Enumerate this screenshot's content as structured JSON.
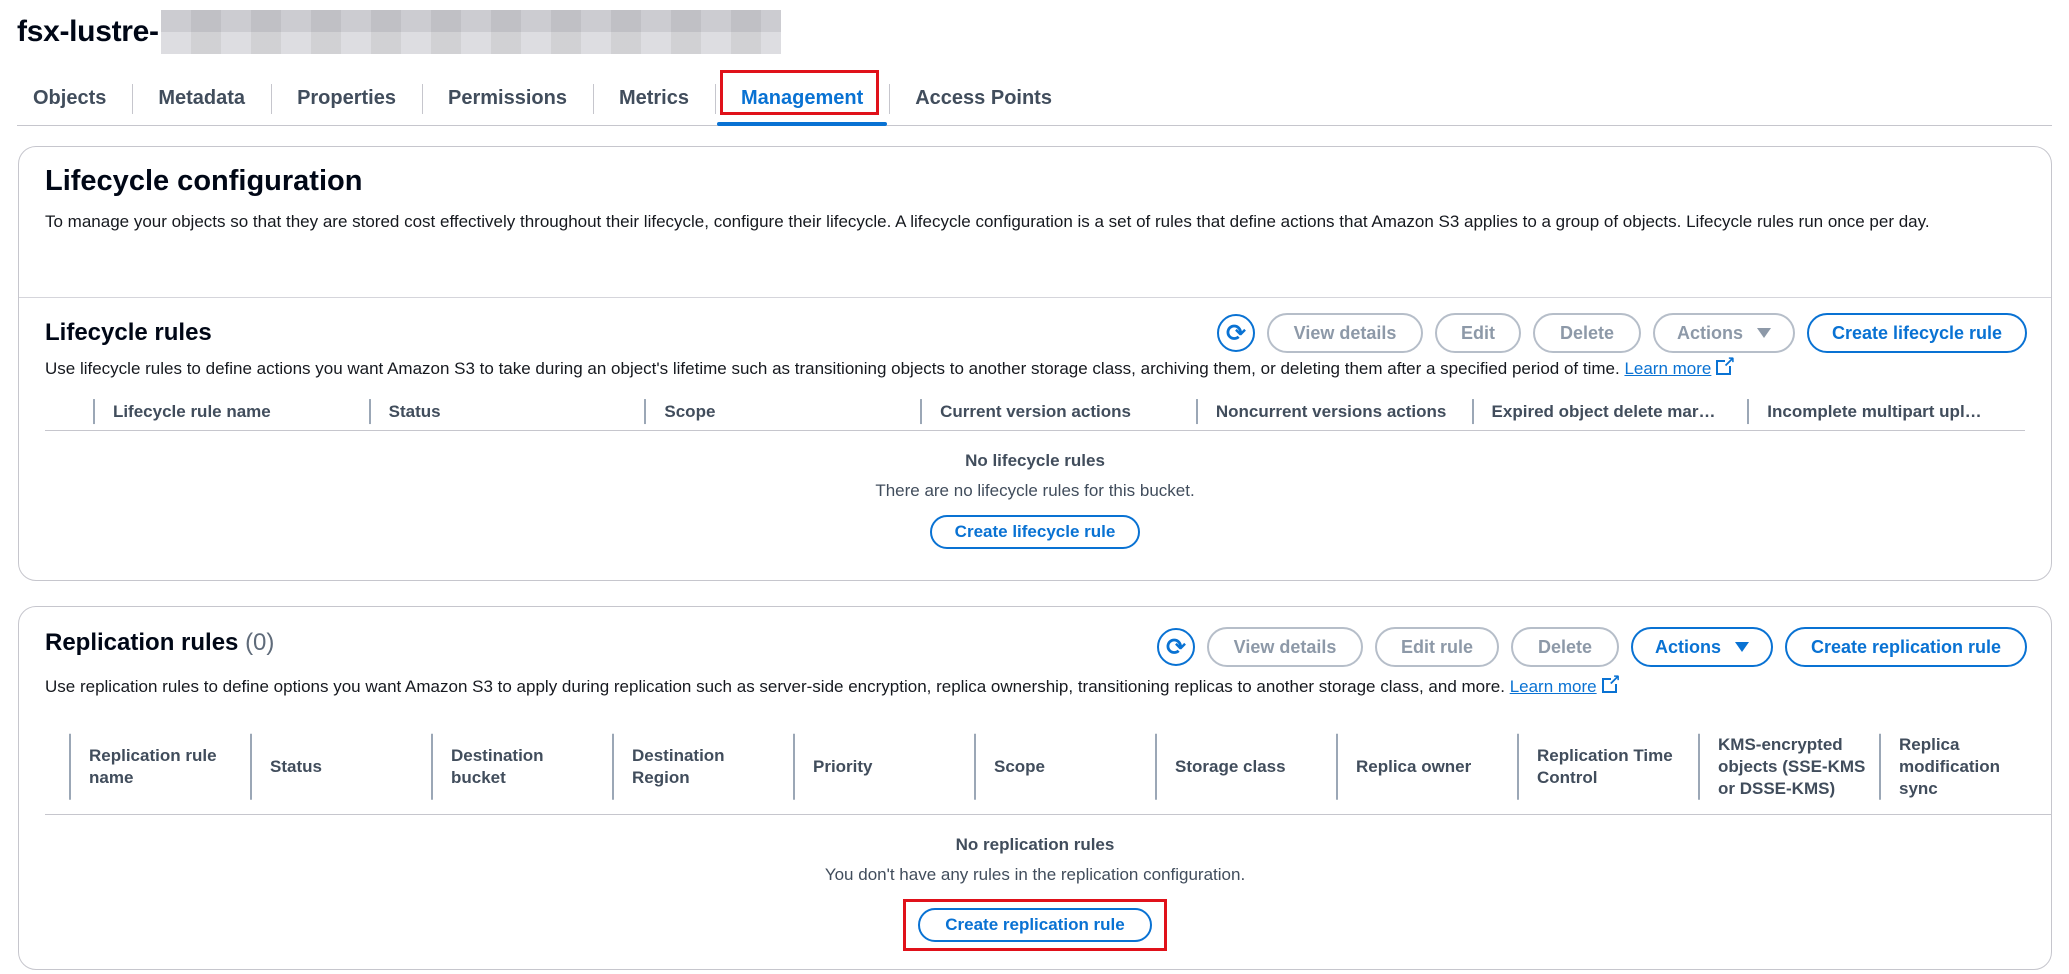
{
  "bucket": {
    "name_prefix": "fsx-lustre-"
  },
  "tabs": [
    {
      "label": "Objects"
    },
    {
      "label": "Metadata"
    },
    {
      "label": "Properties"
    },
    {
      "label": "Permissions"
    },
    {
      "label": "Metrics"
    },
    {
      "label": "Management",
      "active": true
    },
    {
      "label": "Access Points"
    }
  ],
  "lifecycle": {
    "title": "Lifecycle configuration",
    "description": "To manage your objects so that they are stored cost effectively throughout their lifecycle, configure their lifecycle. A lifecycle configuration is a set of rules that define actions that Amazon S3 applies to a group of objects. Lifecycle rules run once per day.",
    "rules_title": "Lifecycle rules",
    "rules_description": "Use lifecycle rules to define actions you want Amazon S3 to take during an object's lifetime such as transitioning objects to another storage class, archiving them, or deleting them after a specified period of time.",
    "learn_more": "Learn more",
    "buttons": {
      "view_details": "View details",
      "edit": "Edit",
      "delete": "Delete",
      "actions": "Actions",
      "create": "Create lifecycle rule"
    },
    "columns": [
      "Lifecycle rule name",
      "Status",
      "Scope",
      "Current version actions",
      "Noncurrent versions actions",
      "Expired object delete mar…",
      "Incomplete multipart upl…"
    ],
    "empty_title": "No lifecycle rules",
    "empty_text": "There are no lifecycle rules for this bucket.",
    "empty_button": "Create lifecycle rule"
  },
  "replication": {
    "title": "Replication rules",
    "count": "(0)",
    "description": "Use replication rules to define options you want Amazon S3 to apply during replication such as server-side encryption, replica ownership, transitioning replicas to another storage class, and more.",
    "learn_more": "Learn more",
    "buttons": {
      "view_details": "View details",
      "edit_rule": "Edit rule",
      "delete": "Delete",
      "actions": "Actions",
      "create": "Create replication rule"
    },
    "columns": [
      "Replication rule name",
      "Status",
      "Destination bucket",
      "Destination Region",
      "Priority",
      "Scope",
      "Storage class",
      "Replica owner",
      "Replication Time Control",
      "KMS-encrypted objects (SSE-KMS or DSSE-KMS)",
      "Replica modification sync"
    ],
    "empty_title": "No replication rules",
    "empty_text": "You don't have any rules in the replication configuration.",
    "empty_button": "Create replication rule"
  },
  "icons": {
    "refresh": "refresh-icon",
    "external": "external-link-icon",
    "caret": "caret-down-icon"
  },
  "colors": {
    "accent": "#0972d3",
    "highlight": "#e0111a",
    "disabled": "#8d99a8"
  }
}
